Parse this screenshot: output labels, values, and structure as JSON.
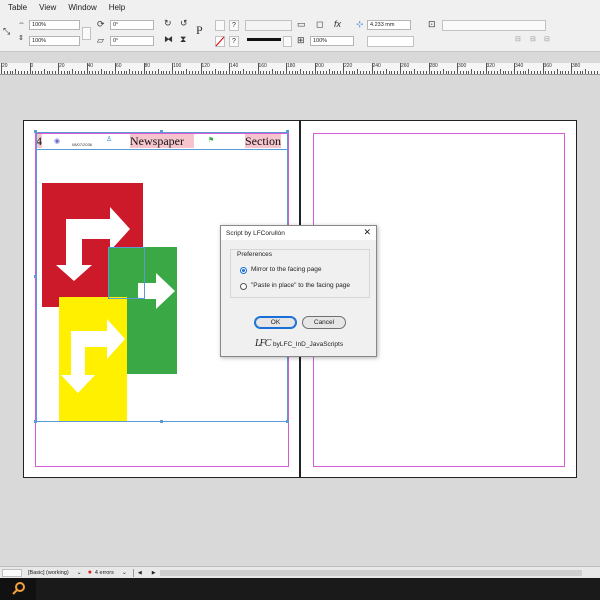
{
  "menu": [
    "Table",
    "View",
    "Window",
    "Help"
  ],
  "control": {
    "scale_x": "100%",
    "scale_y": "100%",
    "rotate": "0°",
    "shear": "0°",
    "stroke_weight_pct": "100%",
    "spacing": "4.233 mm",
    "paragraph_glyph": "P",
    "help_q1": "?",
    "help_q2": "?"
  },
  "ruler": {
    "numbers": [
      "20",
      "0",
      "20",
      "40",
      "60",
      "80",
      "100",
      "120",
      "140",
      "160",
      "180",
      "200",
      "220",
      "240",
      "260",
      "280",
      "300",
      "320",
      "340",
      "360",
      "380",
      "400",
      "420"
    ]
  },
  "page_header": {
    "page_number": "4",
    "date": "08/07/2036",
    "title": "Newspaper",
    "section": "Section"
  },
  "colors": {
    "red": "#cc1a2a",
    "green": "#3aa844",
    "yellow": "#fff000",
    "margin": "#d65ad6",
    "selection": "#5a9bd5",
    "accent": "#1a6fd6"
  },
  "dialog": {
    "title": "Script by LFCorullón",
    "close_glyph": "✕",
    "group_label": "Preferences",
    "option_mirror": "Mirror to the facing page",
    "option_paste": "\"Paste in place\" to the facing page",
    "selected": "mirror",
    "ok_label": "OK",
    "cancel_label": "Cancel",
    "footer_logo": "LFC",
    "footer_text": "byLFC_InD_JavaScripts"
  },
  "status": {
    "preflight_profile": "[Basic] (working)",
    "errors": "4 errors"
  },
  "icons": [
    "search-icon",
    "rotate-icon",
    "flip-icon",
    "close-icon",
    "chevron-down-icon",
    "error-dot-icon"
  ]
}
